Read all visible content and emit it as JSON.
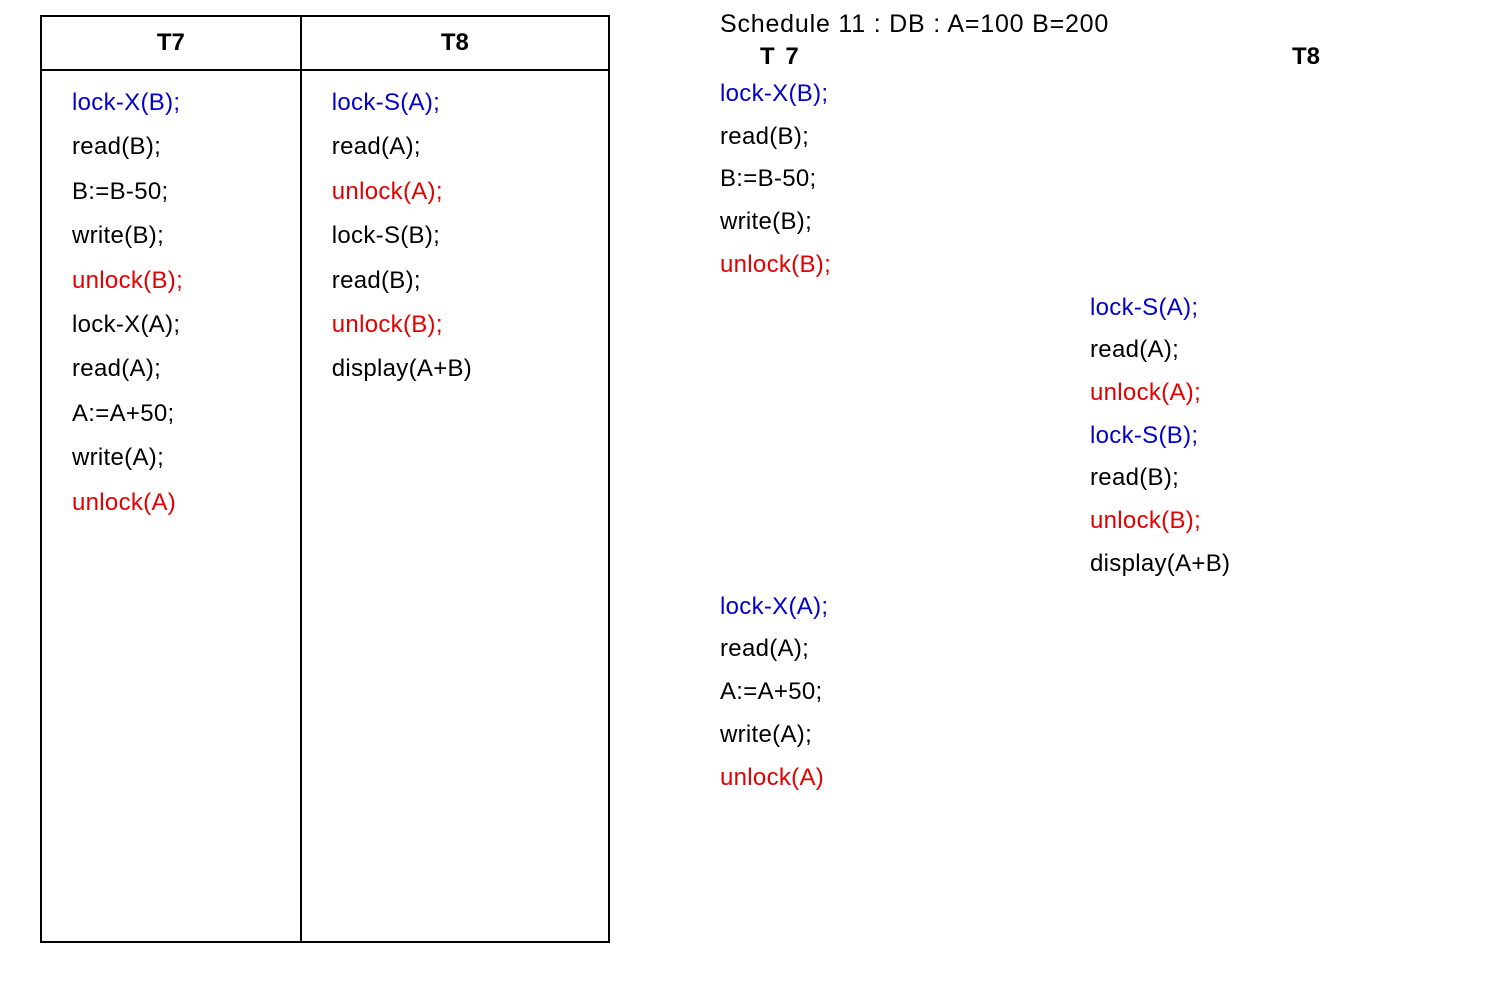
{
  "left_table": {
    "headers": [
      "T7",
      "T8"
    ],
    "t7_ops": [
      {
        "text": "lock-X(B);",
        "color": "blue"
      },
      {
        "text": "read(B);",
        "color": "black"
      },
      {
        "text": "B:=B-50;",
        "color": "black"
      },
      {
        "text": "write(B);",
        "color": "black"
      },
      {
        "text": "unlock(B);",
        "color": "red"
      },
      {
        "text": "lock-X(A);",
        "color": "black"
      },
      {
        "text": "read(A);",
        "color": "black"
      },
      {
        "text": "A:=A+50;",
        "color": "black"
      },
      {
        "text": "write(A);",
        "color": "black"
      },
      {
        "text": "unlock(A)",
        "color": "red"
      }
    ],
    "t8_ops": [
      {
        "text": "lock-S(A);",
        "color": "blue"
      },
      {
        "text": "read(A);",
        "color": "black"
      },
      {
        "text": "unlock(A);",
        "color": "red"
      },
      {
        "text": "lock-S(B);",
        "color": "black"
      },
      {
        "text": "read(B);",
        "color": "black"
      },
      {
        "text": "unlock(B);",
        "color": "red"
      },
      {
        "text": "display(A+B)",
        "color": "black"
      }
    ]
  },
  "schedule": {
    "title": "Schedule 11 :   DB :  A=100  B=200",
    "col_headers": {
      "t7": "T 7",
      "t8": "T8"
    },
    "steps": [
      {
        "col": "t7",
        "text": "lock-X(B);",
        "color": "blue"
      },
      {
        "col": "t7",
        "text": "read(B);",
        "color": "black"
      },
      {
        "col": "t7",
        "text": "B:=B-50;",
        "color": "black"
      },
      {
        "col": "t7",
        "text": "write(B);",
        "color": "black"
      },
      {
        "col": "t7",
        "text": "unlock(B);",
        "color": "red"
      },
      {
        "col": "t8",
        "text": "lock-S(A);",
        "color": "blue"
      },
      {
        "col": "t8",
        "text": "read(A);",
        "color": "black"
      },
      {
        "col": "t8",
        "text": "unlock(A);",
        "color": "red"
      },
      {
        "col": "t8",
        "text": "lock-S(B);",
        "color": "blue"
      },
      {
        "col": "t8",
        "text": "read(B);",
        "color": "black"
      },
      {
        "col": "t8",
        "text": "unlock(B);",
        "color": "red"
      },
      {
        "col": "t8",
        "text": "display(A+B)",
        "color": "black"
      },
      {
        "col": "t7",
        "text": "lock-X(A);",
        "color": "blue"
      },
      {
        "col": "t7",
        "text": "read(A);",
        "color": "black"
      },
      {
        "col": "t7",
        "text": "A:=A+50;",
        "color": "black"
      },
      {
        "col": "t7",
        "text": "write(A);",
        "color": "black"
      },
      {
        "col": "t7",
        "text": "unlock(A)",
        "color": "red"
      }
    ]
  }
}
